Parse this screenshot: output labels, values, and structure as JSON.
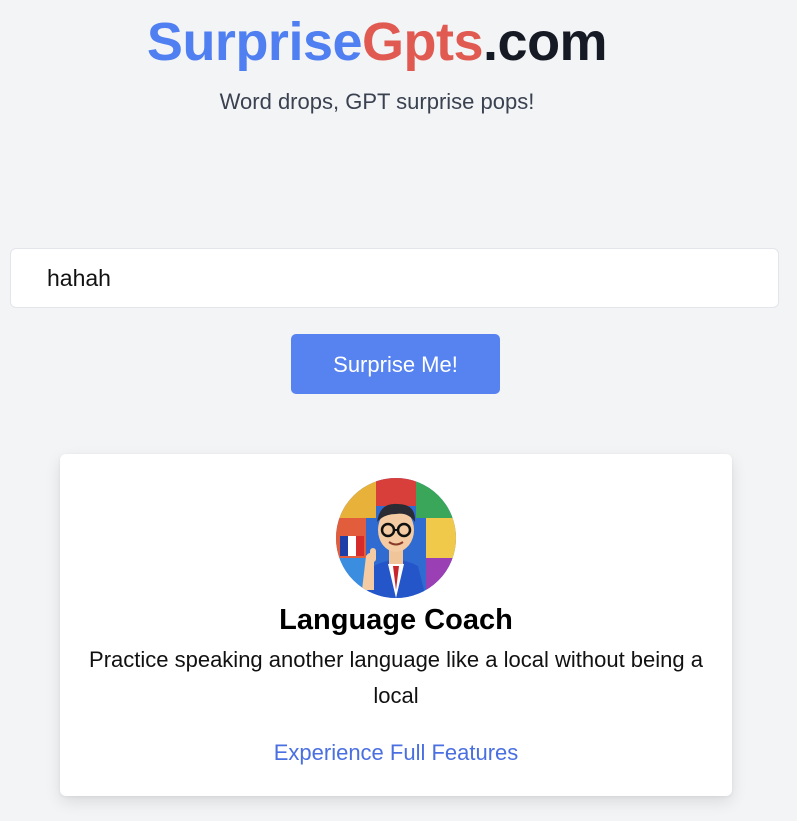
{
  "header": {
    "logo_part1": "Surprise",
    "logo_part2": "Gpts",
    "logo_part3": ".com",
    "tagline": "Word drops, GPT surprise pops!"
  },
  "search": {
    "value": "hahah"
  },
  "actions": {
    "surprise_label": "Surprise Me!"
  },
  "result_card": {
    "avatar_icon": "language-coach-avatar",
    "title": "Language Coach",
    "description": "Practice speaking another language like a local without being a local",
    "link_label": "Experience Full Features"
  },
  "colors": {
    "logo_blue": "#4f7ff0",
    "logo_red": "#e05a52",
    "logo_dark": "#151a24",
    "button_blue": "#5783f1",
    "link_blue": "#4a6fe0",
    "page_bg": "#f3f4f6"
  }
}
